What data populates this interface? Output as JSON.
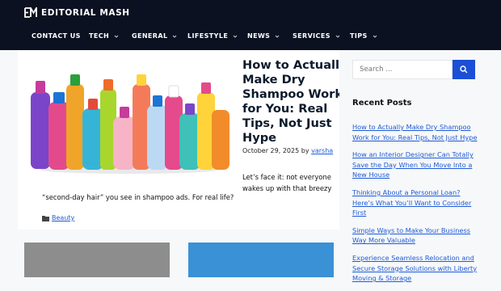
{
  "site": {
    "name": "EDITORIAL MASH"
  },
  "nav": {
    "items": [
      {
        "label": "CONTACT US"
      },
      {
        "label": "TECH"
      },
      {
        "label": "GENERAL"
      },
      {
        "label": "LIFESTYLE"
      },
      {
        "label": "NEWS"
      },
      {
        "label": "SERVICES"
      },
      {
        "label": "TIPS"
      }
    ]
  },
  "post": {
    "title": "How to Actually Make Dry Shampoo Work for You: Real Tips, Not Just Hype",
    "date": "October 29, 2025",
    "by": "by",
    "author": "varsha",
    "excerpt_line1": "Let’s face it: not everyone wakes up with that breezy",
    "excerpt_line2": "“second-day hair” you see in shampoo ads. For real life?",
    "category": "Beauty"
  },
  "sidebar": {
    "search_placeholder": "Search ...",
    "recent_title": "Recent Posts",
    "recent_posts": [
      "How to Actually Make Dry Shampoo Work for You: Real Tips, Not Just Hype",
      "How an Interior Designer Can Totally Save the Day When You Move Into a New House",
      "Thinking About a Personal Loan? Here’s What You’ll Want to Consider First",
      "Simple Ways to Make Your Business Way More Valuable",
      "Experience Seamless Relocation and Secure Storage Solutions with Liberty Moving & Storage"
    ]
  },
  "colors": {
    "header_bg": "#0b1120",
    "accent": "#1b4fd6",
    "link": "#1e5bd8"
  },
  "icons": {
    "logo": "em-logo-icon",
    "search": "search-icon",
    "category": "folder-icon",
    "dropdown": "chevron-down-icon"
  }
}
